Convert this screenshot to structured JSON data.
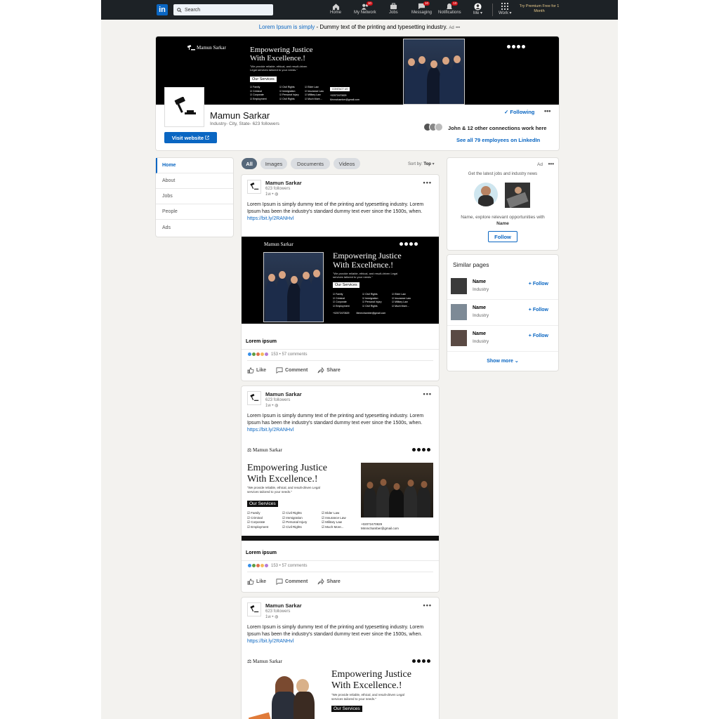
{
  "nav": {
    "logo": "in",
    "search_placeholder": "Search",
    "items": [
      {
        "label": "Home",
        "badge": ""
      },
      {
        "label": "My Network",
        "badge": "10"
      },
      {
        "label": "Jobs",
        "badge": ""
      },
      {
        "label": "Messaging",
        "badge": "10"
      },
      {
        "label": "Notifications",
        "badge": "10"
      },
      {
        "label": "Me",
        "badge": ""
      },
      {
        "label": "Work",
        "badge": ""
      }
    ],
    "premium": "Try Premium Free for 1 Month"
  },
  "ad_banner": {
    "link": "Lorem Ipsum is simply",
    "text": "- Dummy text of the printing and typesetting industry.",
    "tag": "Ad"
  },
  "company": {
    "name": "Mamun Sarkar",
    "meta": "Industry- City, State- 623 followers",
    "visit": "Visit website",
    "following": "Following",
    "connections": "John & 12 other connections work here",
    "employees": "See all 79 employees on LinkedIn"
  },
  "marketing": {
    "brand": "Mamun Sarkar",
    "headline1": "Empowering Justice",
    "headline2": "With Excellence.!",
    "sub": "\"We provide reliable, ethical, and result-driven Legal services tailored to your needs.\"",
    "services_label": "Our Services",
    "col1": [
      "Family",
      "Criminal",
      "Corporate",
      "Employment"
    ],
    "col2": [
      "Civil Rights",
      "Immigration",
      "Personal Injury",
      "Civil Rights"
    ],
    "col3": [
      "Elder Law",
      "Insurance Law",
      "Military Law",
      "Much More..."
    ],
    "phone": "+02072470829",
    "email": "Mmmchamber@gmail.com",
    "contact_label": "CONTACT US"
  },
  "sidebar": {
    "items": [
      "Home",
      "About",
      "Jobs",
      "People",
      "Ads"
    ]
  },
  "filters": {
    "items": [
      "All",
      "Images",
      "Documents",
      "Videos"
    ],
    "sort_label": "Sort by:",
    "sort_value": "Top"
  },
  "posts": [
    {
      "author": "Mamun Sarkar",
      "followers": "623 followers",
      "time": "1w •",
      "text": "Lorem Ipsum is simply dummy text of the printing and typesetting industry. Lorem Ipsum has been the industry's standard dummy text ever since the 1500s, when.",
      "link": "https://bit.ly/2RANHvl",
      "caption": "Lorem ipsum",
      "stats": "153 • 57 comments"
    },
    {
      "author": "Mamun Sarkar",
      "followers": "623 followers",
      "time": "1w •",
      "text": "Lorem Ipsum is simply dummy text of the printing and typesetting industry. Lorem Ipsum has been the industry's standard dummy text ever since the 1500s, when.",
      "link": "https://bit.ly/2RANHvl",
      "caption": "Lorem ipsum",
      "stats": "153 • 57 comments"
    },
    {
      "author": "Mamun Sarkar",
      "followers": "623 followers",
      "time": "1w •",
      "text": "Lorem Ipsum is simply dummy text of the printing and typesetting industry. Lorem Ipsum has been the industry's standard dummy text ever since the 1500s, when.",
      "link": "https://bit.ly/2RANHvl"
    }
  ],
  "post_actions": {
    "like": "Like",
    "comment": "Comment",
    "share": "Share"
  },
  "right_ad": {
    "tag": "Ad",
    "title": "Get the latest jobs and industry news",
    "line1": "Name, explore relevant opportunities with",
    "line2": "Name",
    "follow": "Follow"
  },
  "similar": {
    "title": "Similar pages",
    "items": [
      {
        "name": "Name",
        "industry": "Industry",
        "follow": "+ Follow"
      },
      {
        "name": "Name",
        "industry": "Industry",
        "follow": "+ Follow"
      },
      {
        "name": "Name",
        "industry": "Industry",
        "follow": "+ Follow"
      }
    ],
    "show_more": "Show more"
  },
  "colors": {
    "accent": "#0a66c2",
    "nav_bg": "#1d2226",
    "page_bg": "#f3f2ef",
    "badge": "#cc1016"
  }
}
